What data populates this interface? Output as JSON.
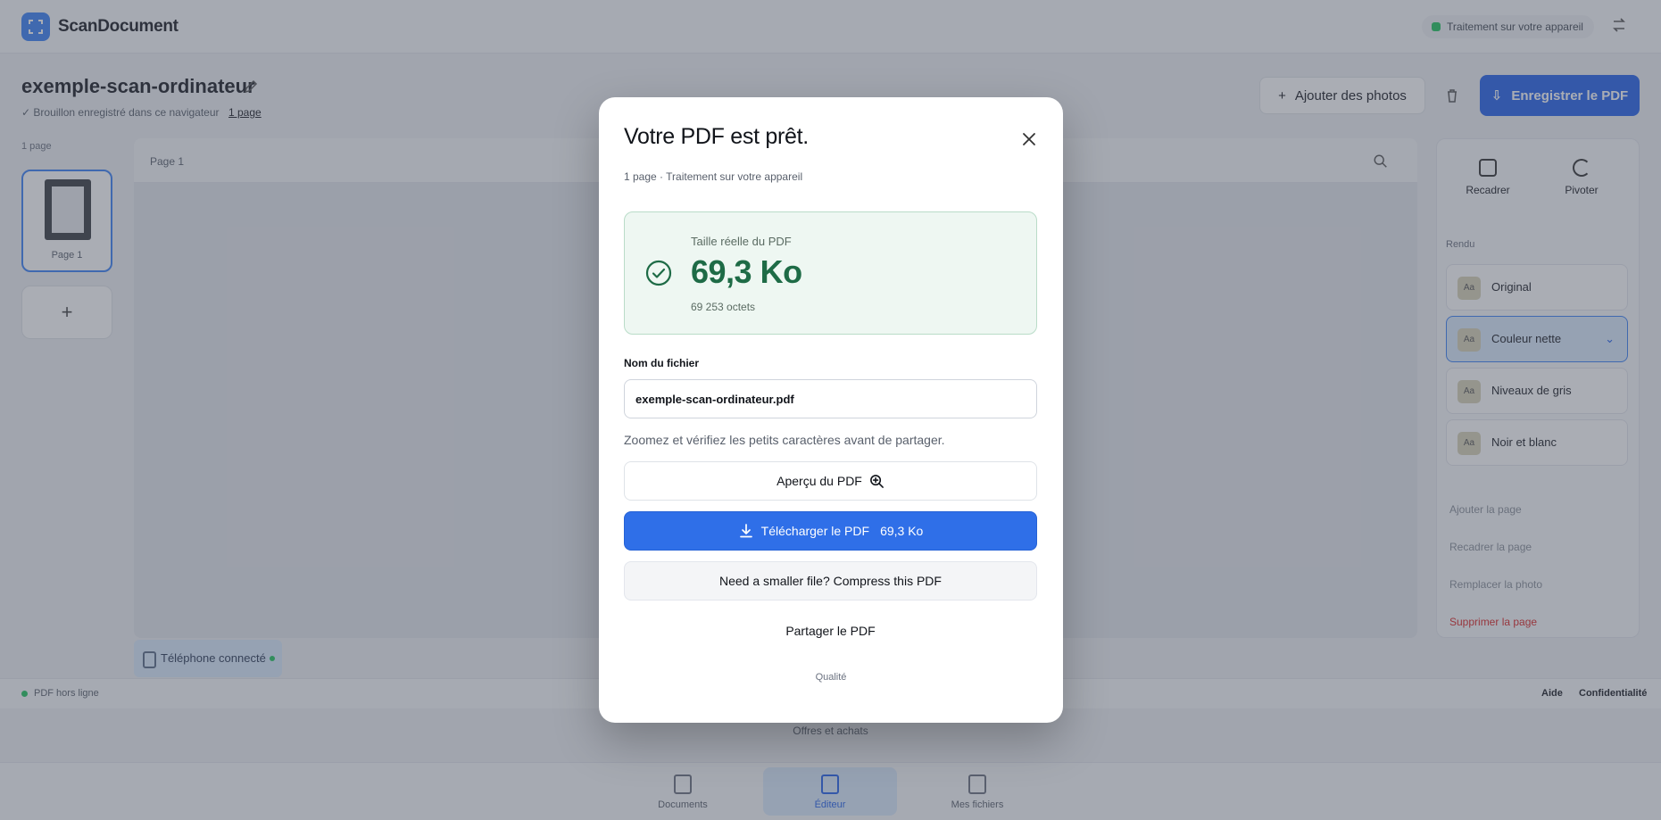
{
  "app": {
    "brand": "ScanDocument",
    "device_status": "Traitement sur votre appareil",
    "document_title": "exemple-scan-ordinateur",
    "save_note": "✓ Brouillon enregistré dans ce navigateur",
    "save_link": "1 page",
    "add_photos_label": "Ajouter des photos",
    "save_pdf_label": "Enregistrer le PDF",
    "pages_label": "1 page",
    "thumb_label": "Page 1",
    "add_page_label": "+",
    "canvas_page_label": "Page 1",
    "phone_badge": "Téléphone connecté",
    "tools": {
      "reframe": "Recadrer",
      "rotate": "Pivoter"
    },
    "render_label": "Rendu",
    "render_options": [
      {
        "label": "Original",
        "swatch": "Aa"
      },
      {
        "label": "Couleur nette",
        "swatch": "Aa",
        "selected": true
      },
      {
        "label": "Niveaux de gris",
        "swatch": "Aa"
      },
      {
        "label": "Noir et blanc",
        "swatch": "Aa"
      }
    ],
    "side_actions": [
      "Ajouter la page",
      "Recadrer la page",
      "Remplacer la photo",
      "Supprimer la page"
    ],
    "footer_status": "PDF hors ligne",
    "footer_links": [
      "Aide",
      "Confidentialité"
    ],
    "offers": "Offres et achats",
    "nav": [
      "Documents",
      "Éditeur",
      "Mes fichiers"
    ]
  },
  "modal": {
    "title": "Votre PDF est prêt.",
    "subtitle": "1 page · Traitement sur votre appareil",
    "size_label": "Taille réelle du PDF",
    "size_value": "69,3 Ko",
    "size_bytes": "69 253 octets",
    "filename_label": "Nom du fichier",
    "filename_value": "exemple-scan-ordinateur.pdf",
    "hint": "Zoomez et vérifiez les petits caractères avant de partager.",
    "preview_label": "Aperçu du PDF",
    "download_label": "Télécharger le PDF",
    "download_size": "69,3 Ko",
    "compress_label": "Need a smaller file? Compress this PDF",
    "share_label": "Partager le PDF",
    "quality_label": "Qualité"
  },
  "colors": {
    "accent": "#2f6fe8",
    "success": "#1e6b46",
    "success_bg": "#eef7f2"
  },
  "icons": {
    "close": "close-icon",
    "success": "check-circle-icon",
    "preview": "zoom-in-icon",
    "download": "download-icon"
  }
}
